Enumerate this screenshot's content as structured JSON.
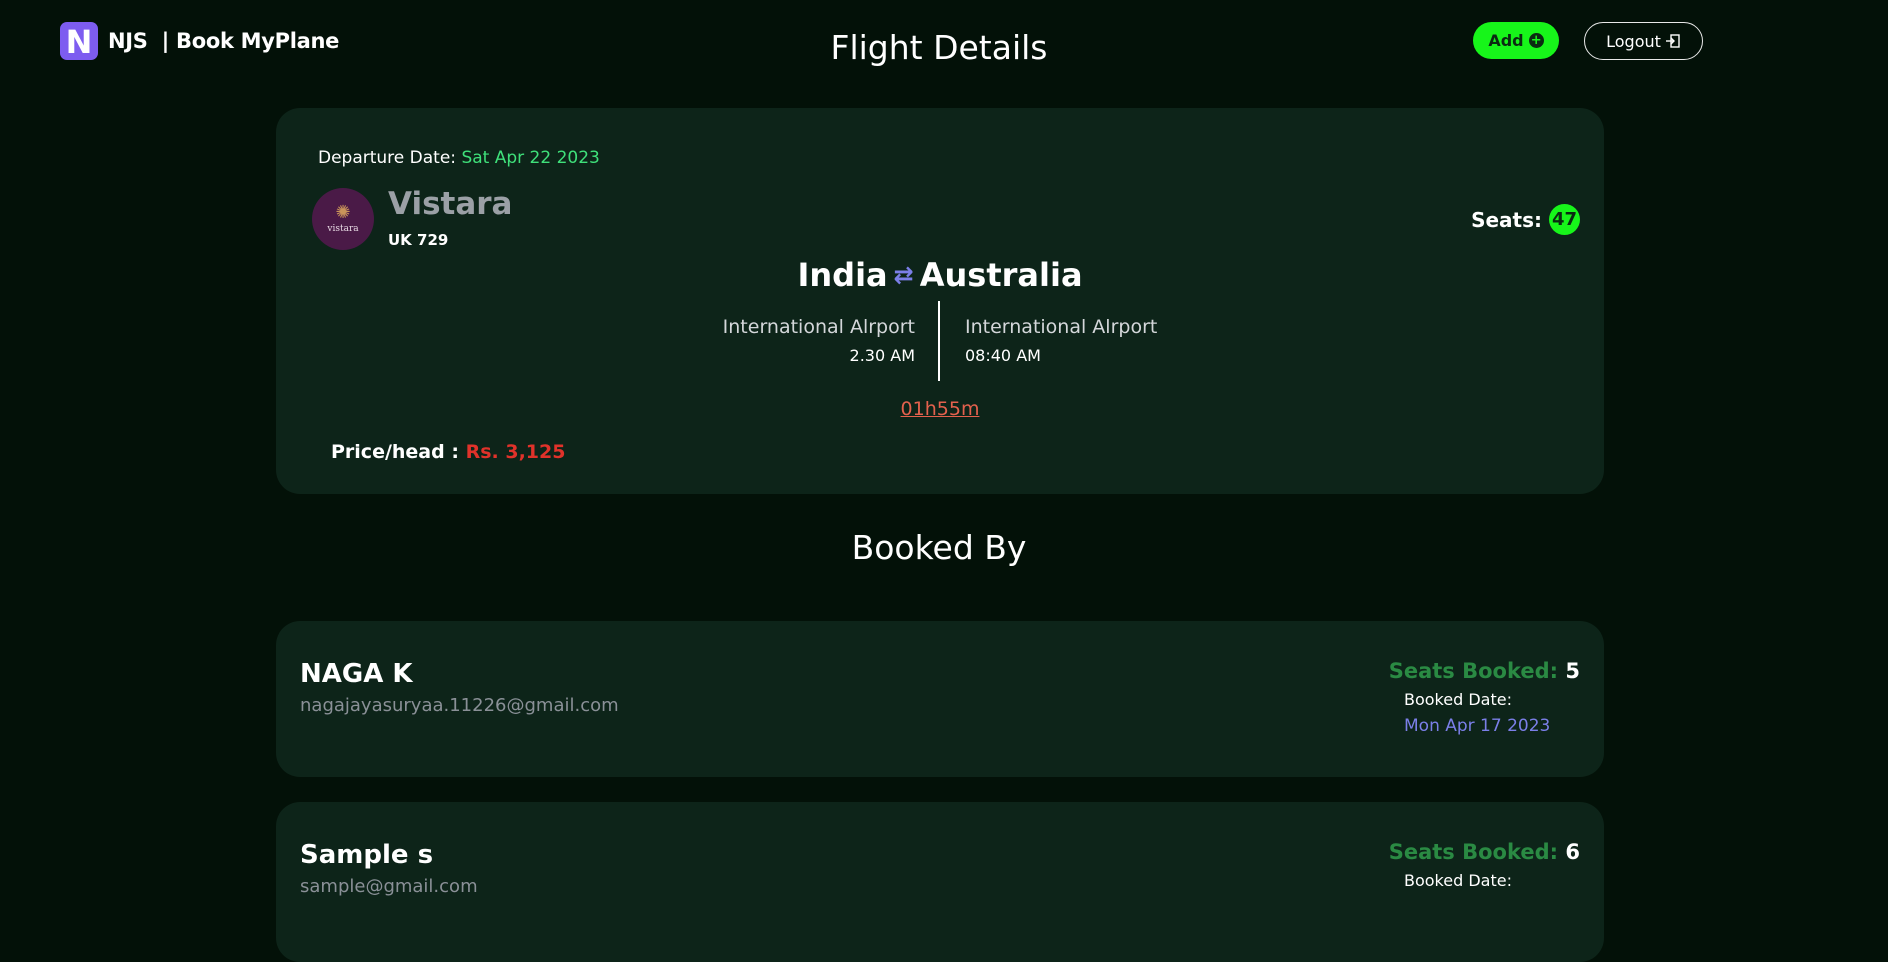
{
  "header": {
    "logo_letter": "N",
    "brand": "NJS",
    "app_name": "| Book MyPlane",
    "page_title": "Flight Details",
    "add_label": "Add",
    "logout_label": "Logout"
  },
  "flight": {
    "departure_label": "Departure Date:",
    "departure_date": "Sat Apr 22 2023",
    "airline_logo_text": "vistara",
    "airline_name": "Vistara",
    "flight_number": "UK 729",
    "seats_label": "Seats:",
    "seats_count": "47",
    "origin": "India",
    "destination": "Australia",
    "route_icon": "swap-arrows-icon",
    "origin_airport": "International Alrport",
    "origin_time": "2.30 AM",
    "destination_airport": "International Alrport",
    "destination_time": "08:40 AM",
    "duration": "01h55m",
    "price_label": "Price/head :",
    "price_value": "Rs. 3,125"
  },
  "booked_title": "Booked By",
  "bookings": [
    {
      "name": "NAGA K",
      "email": "nagajayasuryaa.11226@gmail.com",
      "seats_label": "Seats Booked:",
      "seats": "5",
      "date_label": "Booked Date:",
      "date": "Mon Apr 17 2023"
    },
    {
      "name": "Sample s",
      "email": "sample@gmail.com",
      "seats_label": "Seats Booked:",
      "seats": "6",
      "date_label": "Booked Date:",
      "date": ""
    }
  ],
  "colors": {
    "background": "#031108",
    "card": "#0d2419",
    "accent_green": "#17f51a",
    "date_green": "#3fe07a",
    "price_red": "#e0322a",
    "duration_red": "#e3614d",
    "link_blue": "#7b7fe8",
    "brand_purple": "#7d5cf0"
  }
}
